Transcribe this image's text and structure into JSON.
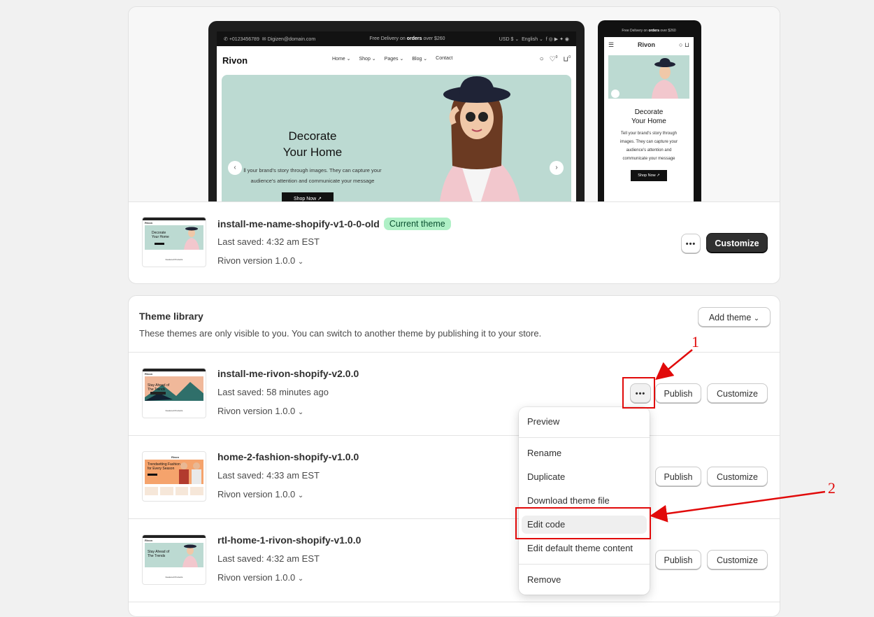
{
  "preview": {
    "topbar_phone": "+0123456789",
    "topbar_email": "Digizen@domain.com",
    "topbar_delivery_pre": "Free Delivery on",
    "topbar_delivery_bold": "orders",
    "topbar_delivery_post": "over $260",
    "topbar_currency": "USD $",
    "topbar_language": "English",
    "logo": "Rivon",
    "nav": [
      "Home",
      "Shop",
      "Pages",
      "Blog",
      "Contact"
    ],
    "cart_count": "0",
    "wishlist_count": "0",
    "hero_title_line1": "Decorate",
    "hero_title_line2": "Your Home",
    "hero_desc_line1": "ll your brand's story through images. They can capture your",
    "hero_desc_line2": "audience's attention and communicate your message",
    "hero_button": "Shop Now",
    "phone_topbar_pre": "Free Delivery on",
    "phone_topbar_bold": "orders",
    "phone_topbar_post": "over $260",
    "phone_logo": "Rivon",
    "phone_title_line1": "Decorate",
    "phone_title_line2": "Your Home",
    "phone_desc": [
      "Tell your brand's story through",
      "images. They can capture your",
      "audience's attention and",
      "communicate your message"
    ],
    "phone_button": "Shop Now"
  },
  "current_theme": {
    "name": "install-me-name-shopify-v1-0-0-old",
    "badge": "Current theme",
    "last_saved": "Last saved: 4:32 am EST",
    "version": "Rivon version 1.0.0",
    "more_label": "•••",
    "customize_label": "Customize",
    "thumb_logo": "Rivon",
    "thumb_title": [
      "Decorate",
      "Your Home"
    ],
    "thumb_footer": "Featured Products"
  },
  "library": {
    "title": "Theme library",
    "subtitle": "These themes are only visible to you. You can switch to another theme by publishing it to your store.",
    "add_theme_label": "Add theme",
    "themes": [
      {
        "name": "install-me-rivon-shopify-v2.0.0",
        "last_saved": "Last saved: 58 minutes ago",
        "version": "Rivon version 1.0.0",
        "publish_label": "Publish",
        "customize_label": "Customize",
        "more_label": "•••",
        "thumb_title": [
          "Stay Ahead of",
          "The Trends"
        ],
        "thumb_logo": "Rivon",
        "thumb_footer": "Featured Products"
      },
      {
        "name": "home-2-fashion-shopify-v1.0.0",
        "last_saved": "Last saved: 4:33 am EST",
        "version": "Rivon version 1.0.0",
        "publish_label": "Publish",
        "customize_label": "Customize",
        "thumb_title": [
          "Trendsetting Fashion",
          "for Every Season"
        ],
        "thumb_logo": "Rivon"
      },
      {
        "name": "rtl-home-1-rivon-shopify-v1.0.0",
        "last_saved": "Last saved: 4:32 am EST",
        "version": "Rivon version 1.0.0",
        "publish_label": "Publish",
        "customize_label": "Customize",
        "thumb_title": [
          "Stay Ahead of",
          "The Trends"
        ],
        "thumb_logo": "Rivon",
        "thumb_footer": "Featured Products"
      }
    ]
  },
  "menu": {
    "items": [
      "Preview",
      "Rename",
      "Duplicate",
      "Download theme file",
      "Edit code",
      "Edit default theme content",
      "Remove"
    ]
  },
  "annotations": {
    "step1": "1",
    "step2": "2",
    "color": "#e10a0a"
  },
  "colors": {
    "badge_bg": "#aff0c6",
    "badge_text": "#0c5132",
    "primary_button": "#303030",
    "hero_bg": "#bcdad2"
  }
}
